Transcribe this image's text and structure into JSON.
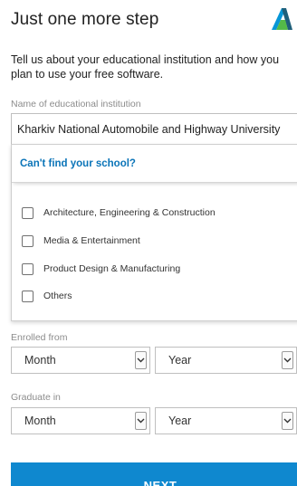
{
  "header": {
    "title": "Just one more step",
    "logo_icon": "autodesk-logo-icon"
  },
  "subtitle": "Tell us about your educational institution and how you plan to use your free software.",
  "institution": {
    "label": "Name of educational institution",
    "value": "Kharkiv National Automobile and Highway University"
  },
  "dropdown": {
    "cant_find_label": "Can't find your school?",
    "options": [
      {
        "label": "Architecture, Engineering & Construction",
        "checked": false
      },
      {
        "label": "Media & Entertainment",
        "checked": false
      },
      {
        "label": "Product Design & Manufacturing",
        "checked": false
      },
      {
        "label": "Others",
        "checked": false
      }
    ]
  },
  "enrolled": {
    "label": "Enrolled from",
    "month": "Month",
    "year": "Year"
  },
  "graduate": {
    "label": "Graduate in",
    "month": "Month",
    "year": "Year"
  },
  "next_label": "NEXT",
  "colors": {
    "accent": "#0f88cf",
    "link": "#0a74b8",
    "logo_teal": "#0696d7",
    "logo_green": "#54b948",
    "logo_dark": "#1f5f7a"
  }
}
